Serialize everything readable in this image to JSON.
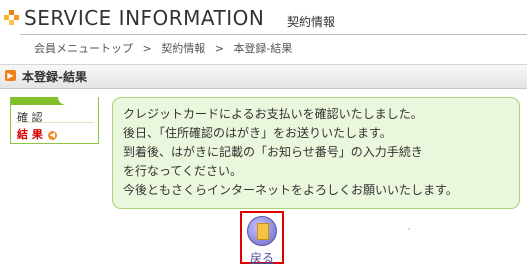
{
  "header": {
    "title": "SERVICE INFORMATION",
    "subtitle": "契約情報"
  },
  "breadcrumb": {
    "items": [
      "会員メニュートップ",
      "契約情報",
      "本登録-結果"
    ],
    "separator": ">"
  },
  "section": {
    "title": "本登録-結果",
    "icon": "play-icon"
  },
  "steps": {
    "items": [
      {
        "label": "確 認"
      },
      {
        "label": "結 果"
      }
    ]
  },
  "message": {
    "lines": [
      "クレジットカードによるお支払いを確認いたしました。",
      "後日、「住所確認のはがき」をお送りいたします。",
      "到着後、はがきに記載の「お知らせ番号」の入力手続き",
      "を行なってください。",
      "今後ともさくらインターネットをよろしくお願いいたします。"
    ]
  },
  "back_button": {
    "label": "戻る",
    "icon": "document-icon"
  },
  "colors": {
    "accent": "#ef7f1a",
    "step_active": "#d60000",
    "green_border": "#8dc63f",
    "message_bg": "#eaf7dc",
    "highlight_border": "#e00000"
  }
}
